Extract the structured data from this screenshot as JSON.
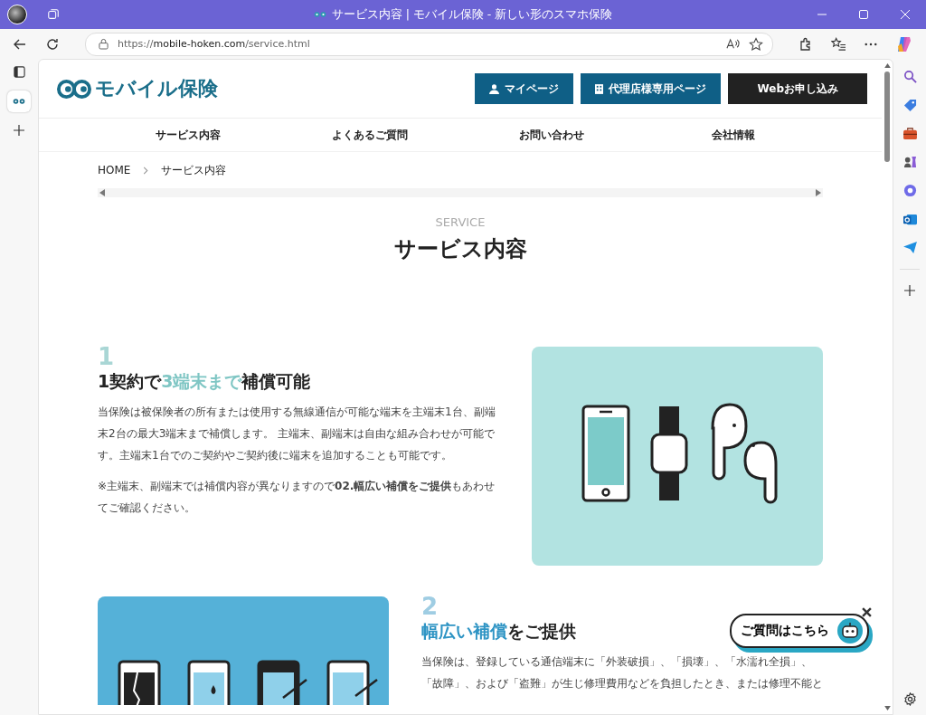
{
  "window": {
    "title": "サービス内容 | モバイル保険 - 新しい形のスマホ保険"
  },
  "address_bar": {
    "scheme": "https://",
    "host": "mobile-hoken.com",
    "path": "/service.html"
  },
  "header": {
    "logo": "モバイル保険",
    "buttons": [
      {
        "label": "マイページ",
        "kind": "user"
      },
      {
        "label": "代理店様専用ページ",
        "kind": "building"
      },
      {
        "label": "Webお申し込み",
        "kind": "dark"
      }
    ]
  },
  "nav": [
    "サービス内容",
    "よくあるご質問",
    "お問い合わせ",
    "会社情報"
  ],
  "breadcrumb": [
    "HOME",
    "サービス内容"
  ],
  "page_heading": {
    "eyebrow": "SERVICE",
    "title": "サービス内容"
  },
  "sections": [
    {
      "number": "1",
      "heading": [
        {
          "text": "1契約で",
          "accent": false
        },
        {
          "text": "3端末まで",
          "accent": true
        },
        {
          "text": "補償可能",
          "accent": false
        }
      ],
      "paragraphs": [
        "当保険は被保険者の所有または使用する無線通信が可能な端末を主端末1台、副端末2台の最大3端末まで補償します。 主端末、副端末は自由な組み合わせが可能です。主端末1台でのご契約やご契約後に端末を追加することも可能です。",
        "※主端末、副端末では補償内容が異なりますので**02.幅広い補償をご提供**もあわせてご確認ください。"
      ]
    },
    {
      "number": "2",
      "heading": [
        {
          "text": "幅広い補償",
          "accent": true
        },
        {
          "text": "をご提供",
          "accent": false
        }
      ],
      "paragraphs": [
        "当保険は、登録している通信端末に「外装破損」、「損壊」、「水濡れ全損」、「故障」、および「盗難」が生じ修理費用などを負担したとき、または修理不能と"
      ]
    }
  ],
  "chat_bubble": {
    "label": "ご質問はこちら"
  }
}
